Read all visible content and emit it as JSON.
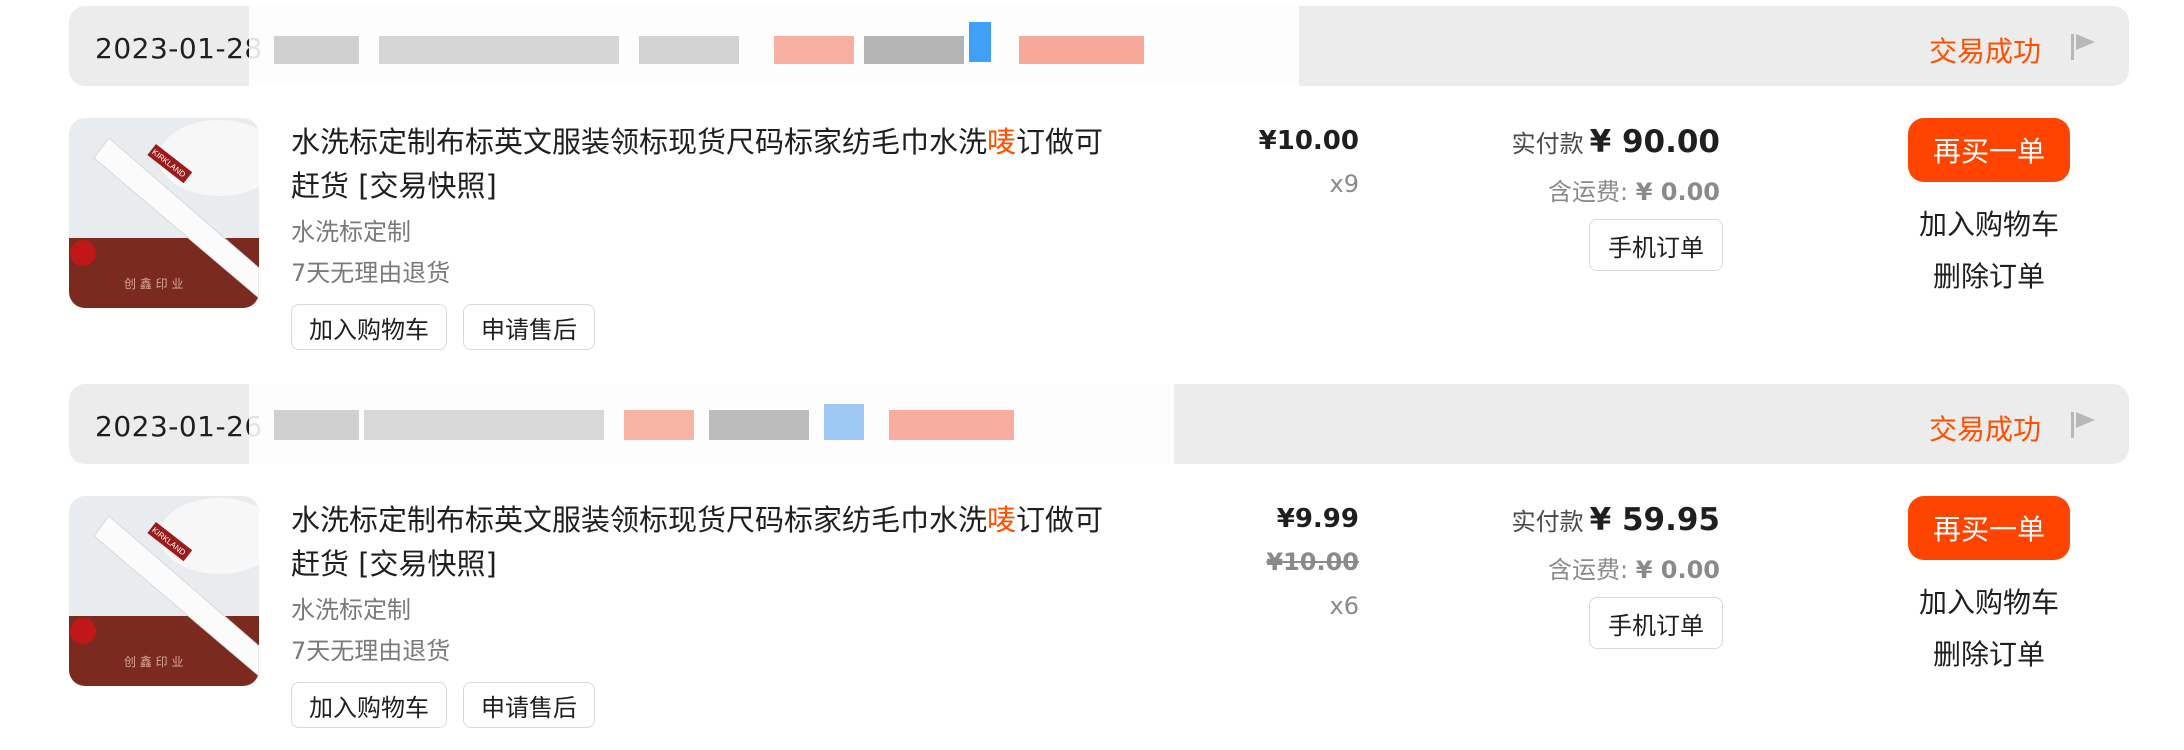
{
  "orders": [
    {
      "date": "2023-01-28",
      "status": "交易成功",
      "title_a": "水洗标定制布标英文服装领标现货尺码标家纺毛巾水洗",
      "title_hl": "唛",
      "title_b": "订做可赶货 [交易快照]",
      "sku": "水洗标定制",
      "policy": "7天无理由退货",
      "btn_cart": "加入购物车",
      "btn_after": "申请售后",
      "price": "¥10.00",
      "price_old": "",
      "qty": "x9",
      "paid_label": "实付款",
      "paid_amount": "¥ 90.00",
      "ship_label": "含运费:",
      "ship_amount": "¥ 0.00",
      "mobile_order": "手机订单",
      "buy_again": "再买一单",
      "add_cart": "加入购物车",
      "delete_order": "删除订单"
    },
    {
      "date": "2023-01-26",
      "status": "交易成功",
      "title_a": "水洗标定制布标英文服装领标现货尺码标家纺毛巾水洗",
      "title_hl": "唛",
      "title_b": "订做可赶货 [交易快照]",
      "sku": "水洗标定制",
      "policy": "7天无理由退货",
      "btn_cart": "加入购物车",
      "btn_after": "申请售后",
      "price": "¥9.99",
      "price_old": "¥10.00",
      "qty": "x6",
      "paid_label": "实付款",
      "paid_amount": "¥ 59.95",
      "ship_label": "含运费:",
      "ship_amount": "¥ 0.00",
      "mobile_order": "手机订单",
      "buy_again": "再买一单",
      "add_cart": "加入购物车",
      "delete_order": "删除订单"
    }
  ],
  "thumb_brand": "KIRKLAND",
  "thumb_watermark": "创 鑫 印 业",
  "colors": {
    "accent": "#ff5000",
    "button": "#ff4400",
    "header_bg": "#ececec"
  }
}
